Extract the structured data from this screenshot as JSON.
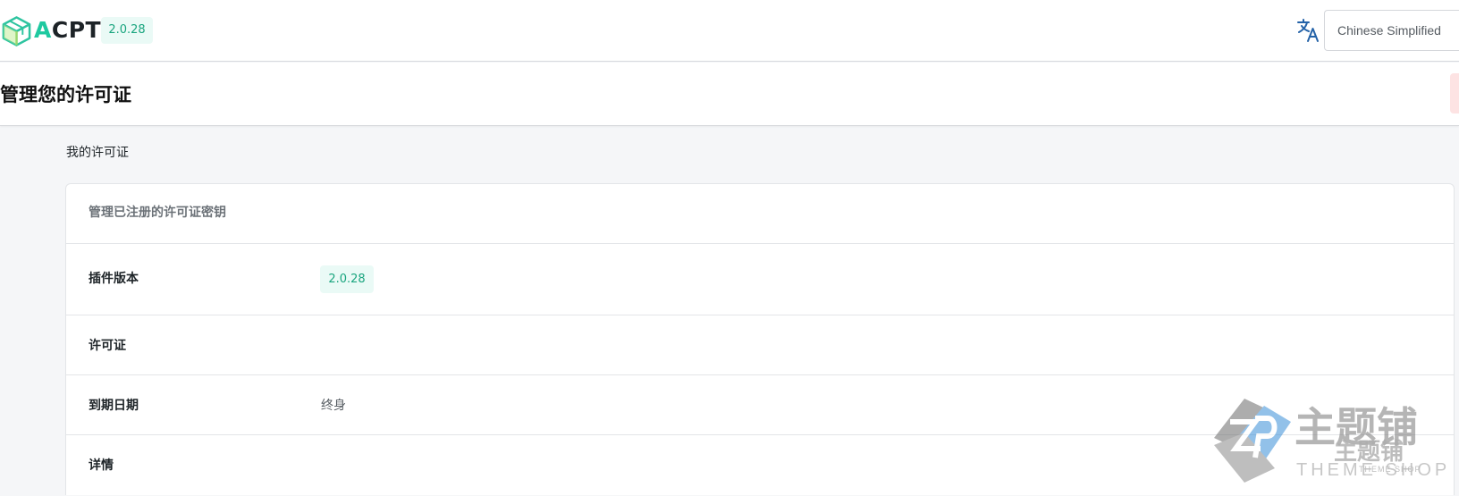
{
  "header": {
    "brand_first": "A",
    "brand_rest": "CPT",
    "version": "2.0.28",
    "language_select": "Chinese Simplified"
  },
  "title_bar": {
    "title": "管理您的许可证"
  },
  "breadcrumb": "我的许可证",
  "license_card": {
    "header": "管理已注册的许可证密钥",
    "rows": [
      {
        "label": "插件版本",
        "value": "2.0.28"
      },
      {
        "label": "许可证",
        "value": ""
      },
      {
        "label": "到期日期",
        "value": "终身"
      },
      {
        "label": "详情",
        "value": ""
      }
    ]
  },
  "watermark": {
    "text_cn": "主题铺",
    "text_en": "THEME SHOP",
    "small_cn": "主题铺",
    "small_en": "THEME SHOP"
  },
  "colors": {
    "accent": "#1ec9a0",
    "badge_bg": "#eafaf6",
    "badge_text": "#1aa57f",
    "icon_blue": "#2563a8",
    "page_bg": "#f5f6f8"
  },
  "icons": [
    "acpt-logo-cube-icon",
    "translate-icon",
    "theme-shop-watermark-logo"
  ]
}
